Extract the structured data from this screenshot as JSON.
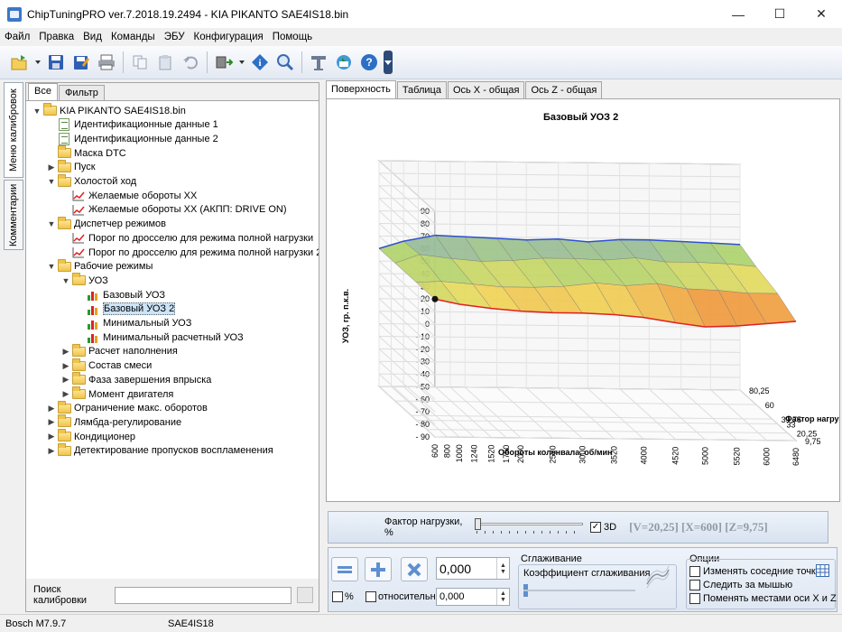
{
  "window": {
    "title": "ChipTuningPRO ver.7.2018.19.2494 - KIA PIKANTO SAE4IS18.bin",
    "minimize": "—",
    "maximize": "☐",
    "close": "✕"
  },
  "menu": [
    "Файл",
    "Правка",
    "Вид",
    "Команды",
    "ЭБУ",
    "Конфигурация",
    "Помощь"
  ],
  "vertical_tabs": [
    "Меню калибровок",
    "Комментарии"
  ],
  "left_tabs": [
    "Все",
    "Фильтр"
  ],
  "tree": [
    {
      "label": "KIA PIKANTO SAE4IS18.bin",
      "level": 0,
      "icon": "folder",
      "arrow": "▼"
    },
    {
      "label": "Идентификационные данные 1",
      "level": 1,
      "icon": "doc",
      "arrow": ""
    },
    {
      "label": "Идентификационные данные 2",
      "level": 1,
      "icon": "doc",
      "arrow": ""
    },
    {
      "label": "Маска DTC",
      "level": 1,
      "icon": "folder",
      "arrow": ""
    },
    {
      "label": "Пуск",
      "level": 1,
      "icon": "folder",
      "arrow": "▶"
    },
    {
      "label": "Холостой ход",
      "level": 1,
      "icon": "folder",
      "arrow": "▼"
    },
    {
      "label": "Желаемые обороты XX",
      "level": 2,
      "icon": "graph",
      "arrow": ""
    },
    {
      "label": "Желаемые обороты XX (АКПП: DRIVE ON)",
      "level": 2,
      "icon": "graph",
      "arrow": ""
    },
    {
      "label": "Диспетчер режимов",
      "level": 1,
      "icon": "folder",
      "arrow": "▼"
    },
    {
      "label": "Порог по дросселю для режима полной нагрузки",
      "level": 2,
      "icon": "graph",
      "arrow": ""
    },
    {
      "label": "Порог по дросселю для режима полной нагрузки 2",
      "level": 2,
      "icon": "graph",
      "arrow": ""
    },
    {
      "label": "Рабочие режимы",
      "level": 1,
      "icon": "folder",
      "arrow": "▼"
    },
    {
      "label": "УОЗ",
      "level": 2,
      "icon": "folder",
      "arrow": "▼"
    },
    {
      "label": "Базовый УОЗ",
      "level": 3,
      "icon": "surf",
      "arrow": ""
    },
    {
      "label": "Базовый УОЗ 2",
      "level": 3,
      "icon": "surf",
      "arrow": "",
      "selected": true
    },
    {
      "label": "Минимальный УОЗ",
      "level": 3,
      "icon": "surf",
      "arrow": ""
    },
    {
      "label": "Минимальный расчетный УОЗ",
      "level": 3,
      "icon": "surf",
      "arrow": ""
    },
    {
      "label": "Расчет наполнения",
      "level": 2,
      "icon": "folder",
      "arrow": "▶"
    },
    {
      "label": "Состав смеси",
      "level": 2,
      "icon": "folder",
      "arrow": "▶"
    },
    {
      "label": "Фаза завершения впрыска",
      "level": 2,
      "icon": "folder",
      "arrow": "▶"
    },
    {
      "label": "Момент двигателя",
      "level": 2,
      "icon": "folder",
      "arrow": "▶"
    },
    {
      "label": "Ограничение макс. оборотов",
      "level": 1,
      "icon": "folder",
      "arrow": "▶"
    },
    {
      "label": "Лямбда-регулирование",
      "level": 1,
      "icon": "folder",
      "arrow": "▶"
    },
    {
      "label": "Кондиционер",
      "level": 1,
      "icon": "folder",
      "arrow": "▶"
    },
    {
      "label": "Детектирование пропусков воспламенения",
      "level": 1,
      "icon": "folder",
      "arrow": "▶"
    }
  ],
  "search": {
    "label": "Поиск калибровки",
    "value": ""
  },
  "right_tabs": [
    "Поверхность",
    "Таблица",
    "Ось X - общая",
    "Ось Z - общая"
  ],
  "chart_data": {
    "type": "surface",
    "title": "Базовый УОЗ 2",
    "ylabel": "УОЗ, гр. п.к.в.",
    "xlabel": "Обороты коленвала, об/мин",
    "zlabel": "Фактор нагрузки, %",
    "y_ticks": [
      "90",
      "80",
      "70",
      "60",
      "50",
      "40",
      "30",
      "20",
      "10",
      "0",
      "- 10",
      "- 20",
      "- 30",
      "- 40",
      "- 50",
      "- 60",
      "- 70",
      "- 80",
      "- 90"
    ],
    "x_ticks": [
      "600",
      "800",
      "1000",
      "1240",
      "1520",
      "1760",
      "2000",
      "2520",
      "3000",
      "3520",
      "4000",
      "4520",
      "5000",
      "5520",
      "6000",
      "6480"
    ],
    "z_ticks": [
      "9,75",
      "20,25",
      "33",
      "39,75",
      "60",
      "80,25"
    ],
    "ylim": [
      -90,
      90
    ],
    "x": [
      600,
      1000,
      1520,
      2000,
      2520,
      3000,
      3520,
      4000,
      4520,
      5000,
      5520,
      6000,
      6480
    ],
    "z": [
      9.75,
      33,
      60,
      80.25
    ],
    "values": [
      [
        20,
        16,
        13,
        11,
        10,
        10,
        9,
        7,
        3,
        0,
        1,
        3,
        5
      ],
      [
        20,
        21,
        19,
        17,
        17,
        18,
        21,
        19,
        21,
        17,
        16,
        14,
        14
      ],
      [
        20,
        27,
        24,
        22,
        23,
        25,
        25,
        24,
        26,
        23,
        23,
        22,
        20
      ],
      [
        20,
        26,
        31,
        30,
        29,
        28,
        29,
        27,
        29,
        29,
        28,
        27,
        26
      ]
    ]
  },
  "slider": {
    "label": "Фактор нагрузки, %",
    "checkbox_label": "3D",
    "checked": true,
    "coords": "[V=20,25] [X=600] [Z=9,75]"
  },
  "edit": {
    "value": "0,000",
    "value2": "0,000",
    "percent_label": "%",
    "relative_label": "относительно"
  },
  "smoothing": {
    "title": "Сглаживание",
    "label": "Коэффициент сглаживания"
  },
  "options": {
    "title": "Опции",
    "items": [
      "Изменять соседние точки",
      "Следить за мышью",
      "Поменять местами оси X и Z"
    ]
  },
  "status": {
    "ecu": "Bosch M7.9.7",
    "file": "SAE4IS18"
  }
}
